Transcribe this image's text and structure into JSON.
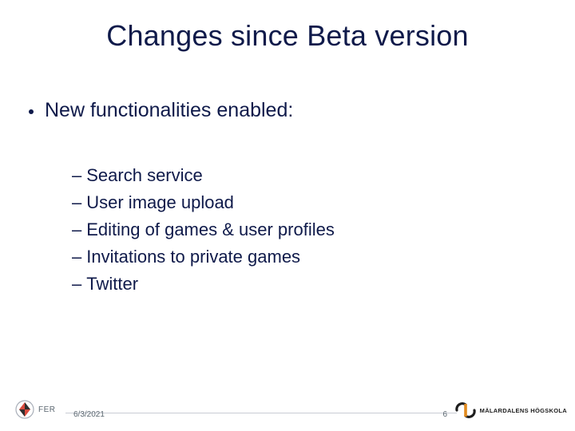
{
  "slide": {
    "title": "Changes since Beta version",
    "bullet": "New functionalities enabled:",
    "sub_items": [
      "Search service",
      "User image upload",
      "Editing of games & user profiles",
      "Invitations to private games",
      "Twitter"
    ]
  },
  "footer": {
    "left_logo_text": "FER",
    "date": "6/3/2021",
    "page_number": "6",
    "right_logo_text": "MÄLARDALENS HÖGSKOLA"
  }
}
